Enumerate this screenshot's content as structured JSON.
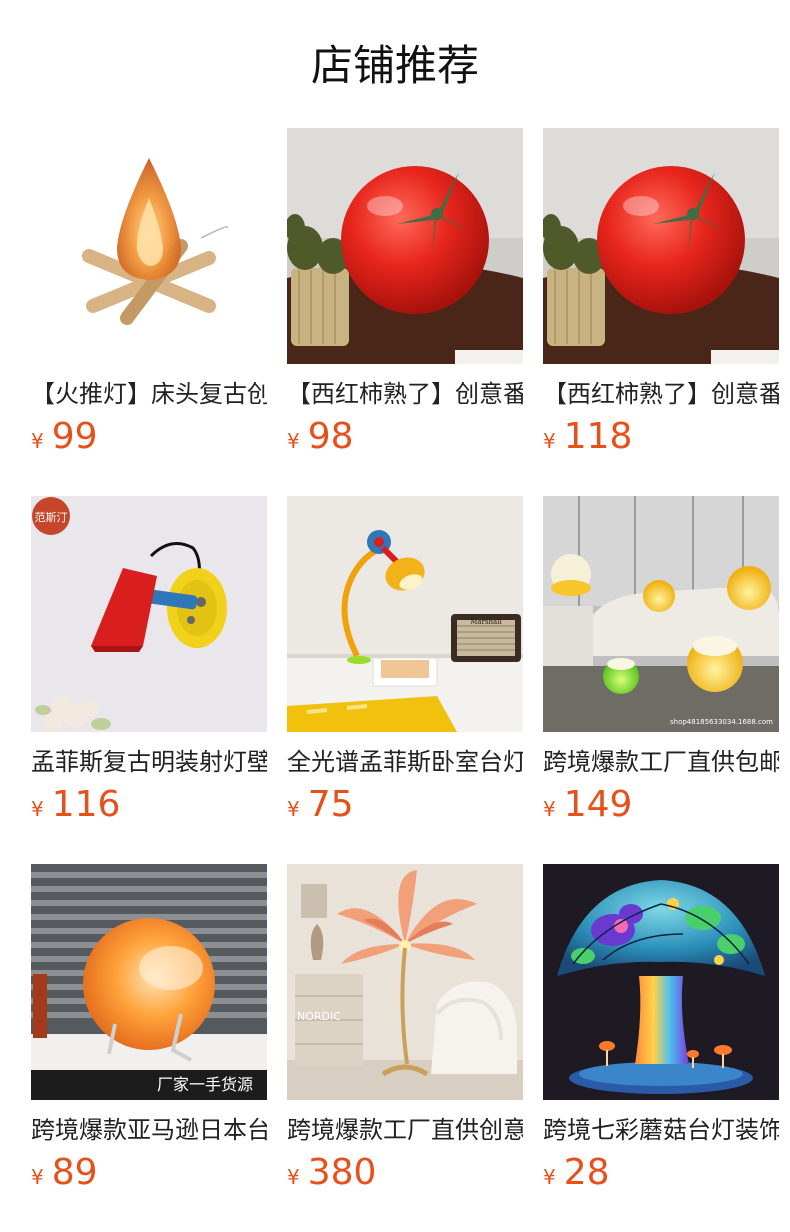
{
  "page": {
    "title": "店铺推荐"
  },
  "products": [
    {
      "name": "【火推灯】床头复古创意",
      "currency": "¥",
      "price": "99",
      "icon": "campfire-lamp-image"
    },
    {
      "name": "【西红柿熟了】创意番茄",
      "currency": "¥",
      "price": "98",
      "icon": "tomato-lamp-image"
    },
    {
      "name": "【西红柿熟了】创意番茄",
      "currency": "¥",
      "price": "118",
      "icon": "tomato-lamp-image"
    },
    {
      "name": "孟菲斯复古明装射灯壁灯",
      "currency": "¥",
      "price": "116",
      "icon": "memphis-wall-lamp-image",
      "badge": "范斯汀"
    },
    {
      "name": "全光谱孟菲斯卧室台灯",
      "currency": "¥",
      "price": "75",
      "icon": "memphis-desk-lamp-image",
      "speaker_text": "Marshall"
    },
    {
      "name": "跨境爆款工厂直供包邮",
      "currency": "¥",
      "price": "149",
      "icon": "glowing-sphere-lamps-image",
      "watermark": "shop48185633034.1688.com"
    },
    {
      "name": "跨境爆款亚马逊日本台灯",
      "currency": "¥",
      "price": "89",
      "icon": "orange-globe-lamp-image",
      "caption": "厂家一手货源"
    },
    {
      "name": "跨境爆款工厂直供创意羽毛",
      "currency": "¥",
      "price": "380",
      "icon": "feather-floor-lamp-image",
      "sign": "NORDIC"
    },
    {
      "name": "跨境七彩蘑菇台灯装饰",
      "currency": "¥",
      "price": "28",
      "icon": "mushroom-lamp-image"
    }
  ]
}
